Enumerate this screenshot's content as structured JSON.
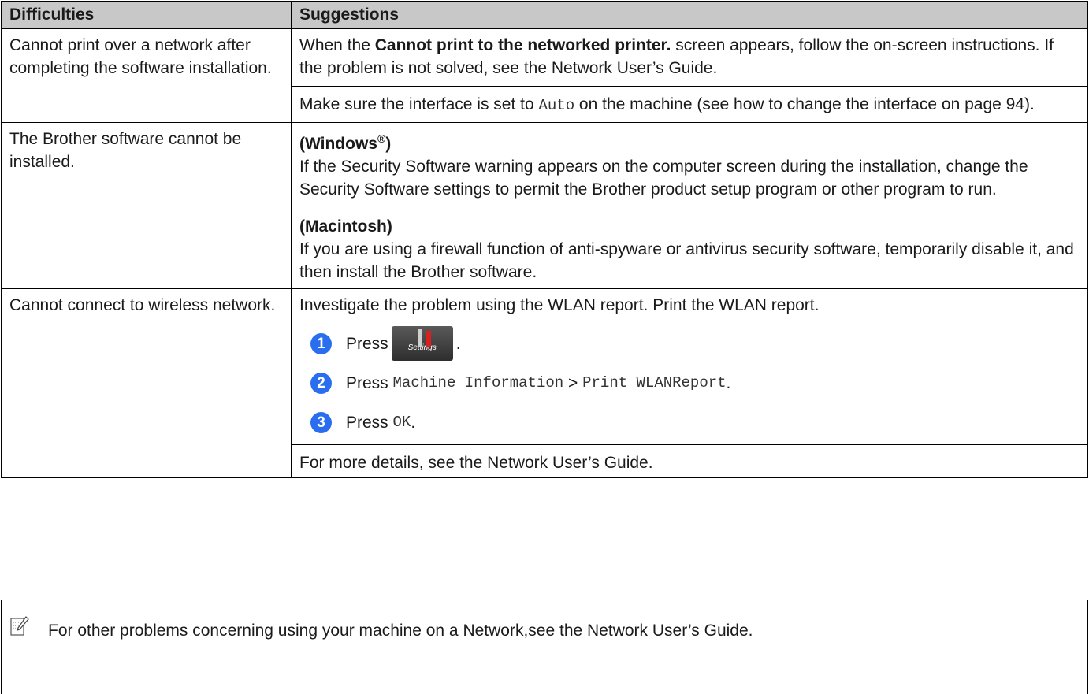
{
  "table": {
    "headers": [
      "Difficulties",
      "Suggestions"
    ],
    "rows": [
      {
        "difficulty": "Cannot print over a network after completing the software installation.",
        "suggestion1_pre": "When the ",
        "suggestion1_bold": "Cannot print to the networked printer.",
        "suggestion1_post": " screen appears, follow the on-screen instructions. If the problem is not solved, see the Network User’s Guide.",
        "suggestion2_pre": "Make sure the interface is set to ",
        "suggestion2_mono": "Auto",
        "suggestion2_post": " on the machine (see how to change the interface on page 94)."
      },
      {
        "difficulty": "The Brother software cannot be installed.",
        "win_heading": "(Windows",
        "win_sup": "®",
        "win_close": ")",
        "win_text": "If the Security Software warning appears on the computer screen during the installation, change the Security Software settings to permit the Brother product setup program or other program to run.",
        "mac_heading": "(Macintosh)",
        "mac_text": "If you are using a firewall function of anti-spyware or antivirus security software, temporarily disable it, and then install the Brother software."
      },
      {
        "difficulty": "Cannot connect to wireless network.",
        "intro": "Investigate the problem using the WLAN report. Print the WLAN report.",
        "steps": [
          {
            "num": "1",
            "press": "Press",
            "icon_label": "Settings",
            "end": "."
          },
          {
            "num": "2",
            "press": "Press",
            "mono1": "Machine Information",
            "sep": " > ",
            "mono2": "Print WLANReport",
            "end": "."
          },
          {
            "num": "3",
            "press": "Press",
            "mono1": "OK",
            "end": "."
          }
        ],
        "outro": "For more details, see the Network User’s Guide."
      }
    ]
  },
  "note": {
    "icon": "note-pencil-icon",
    "text": "For other problems concerning using your machine on a Network,see the Network User’s Guide."
  },
  "colors": {
    "header_bg": "#c8c8c8",
    "step_circle": "#2a6ef0"
  }
}
